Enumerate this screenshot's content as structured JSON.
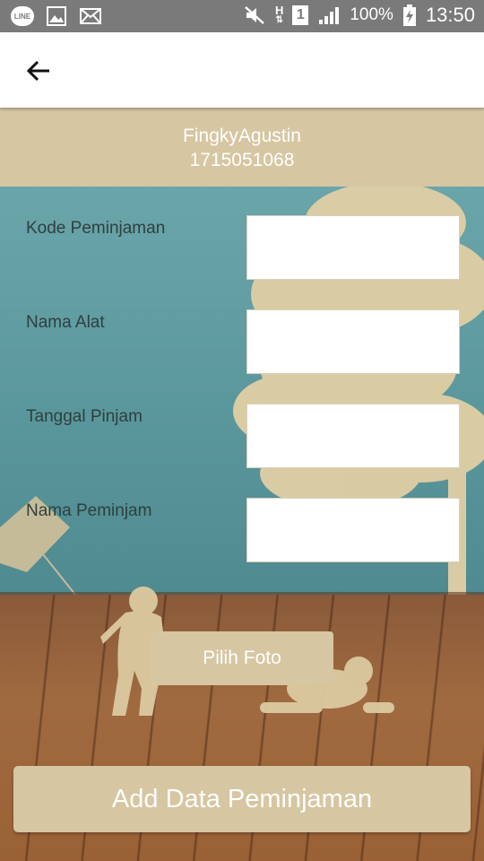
{
  "status_bar": {
    "line_text": "LINE",
    "sim_slot": "1",
    "network_type": "H",
    "battery_percent": "100%",
    "time": "13:50",
    "icons": [
      "line-icon",
      "gallery-icon",
      "mail-icon",
      "mute-icon",
      "network-h-icon",
      "sim-1-icon",
      "signal-icon",
      "battery-charging-icon"
    ]
  },
  "app_bar": {
    "back_icon": "arrow-left-icon"
  },
  "user": {
    "name": "FingkyAgustin",
    "id": "1715051068"
  },
  "form": {
    "fields": [
      {
        "label": "Kode Peminjaman",
        "value": ""
      },
      {
        "label": "Nama Alat",
        "value": ""
      },
      {
        "label": "Tanggal Pinjam",
        "value": ""
      },
      {
        "label": "Nama Peminjam",
        "value": ""
      }
    ],
    "pick_photo_label": "Pilih Foto",
    "submit_label": "Add Data Peminjaman"
  },
  "colors": {
    "accent": "#d6c6a2",
    "status_bar": "#7a7a7a",
    "app_bar": "#ffffff",
    "label_text": "#2f3f3f"
  }
}
